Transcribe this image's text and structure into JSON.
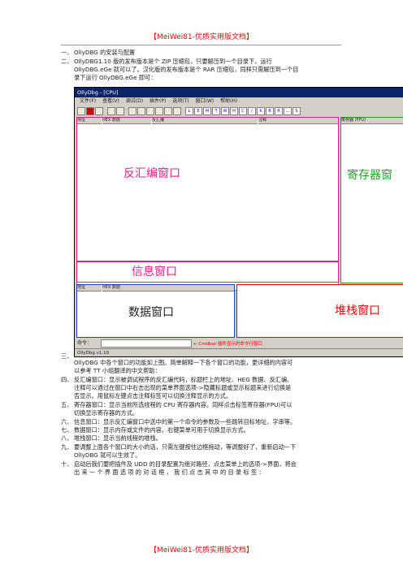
{
  "header_banner": "【MeiWei81-优质实用版文档】",
  "footer_banner": "【MeiWei81-优质实用版文档】",
  "items": [
    {
      "num": "一、",
      "lines": [
        "OllyDBG 的安装与配置"
      ]
    },
    {
      "num": "二、",
      "lines": [
        "OllyDBG1.10 版的发布版本是个 ZIP 压缩包，只要解压到一个目录下，运行",
        "OllyDBG.eGe 就可以了。汉化版的发布版本是个 RAR 压缩包，同样只需解压到一个目",
        "录下运行 OllyDBG.eGe 即可："
      ]
    },
    {
      "num": "三、",
      "lines": [
        "OllyDBG 中各个窗口的功能如上图。简单解释一下各个窗口的功能，更详细的内容可",
        "以参考 TT 小组翻译的中文帮助："
      ]
    },
    {
      "num": "四、",
      "lines": [
        "反汇编窗口：显示被调试程序的反汇编代码，标题栏上的地址、HEG 数据、反汇编、",
        "注释可以通过在窗口中右击出现的菜单界面选项->隐藏标题或显示标题来进行切换是",
        "否显示。用鼠标左键点击注释标签可以切换注释显示的方式。"
      ]
    },
    {
      "num": "五、",
      "lines": [
        "寄存器窗口：显示当前所选线程的 CPU 寄存器内容。同样点击标签寄存器(FPU)可以",
        "切换显示寄存器的方式。"
      ]
    },
    {
      "num": "六、",
      "lines": [
        "信息窗口：显示反汇编窗口中选中的第一个命令的参数及一些跳转目标地址、字串等。"
      ]
    },
    {
      "num": "七、",
      "lines": [
        "数据窗口：显示内存或文件的内容。右键菜单可用于切换显示方式。"
      ]
    },
    {
      "num": "八、",
      "lines": [
        "堆栈窗口：显示当前线程的堆栈。"
      ]
    },
    {
      "num": "九、",
      "lines": [
        "要调整上面各个窗口的大小的话，只需左键按住边框拖动，等调整好了，重新启动一下",
        "OllyDBG 就可以生效了。"
      ]
    },
    {
      "num": "十、",
      "lines": [
        "启动后我们要把插件及 UDD 的目录配置为绝对路径，点击菜单上的选项->界面，将会",
        "出 来 一 个 界 面 选 项 的 对 话 框 ， 我 们 点 击 其 中 的 目 录 标 签 ："
      ]
    }
  ],
  "screenshot": {
    "title": "OllyDbg - [CPU]",
    "menu": [
      "文件(F)",
      "查看(V)",
      "调试(D)",
      "插件(P)",
      "选项(T)",
      "窗口(W)",
      "帮助(H)"
    ],
    "toolbar_letters": [
      "L",
      "E",
      "M",
      "T",
      "W",
      "H",
      "C",
      "/",
      "K",
      "B",
      "R",
      "...",
      "S"
    ],
    "disasm_headers": [
      "地址",
      "HEX 数据",
      "反汇编",
      "注释"
    ],
    "register_header": "寄存器 (FPU)",
    "dump_headers": [
      "地址",
      "HEX 数据"
    ],
    "labels": {
      "disasm": "反汇编窗口",
      "registers": "寄存器窗",
      "info": "信息窗口",
      "dump": "数据窗口",
      "stack": "堆栈窗口"
    },
    "command_label": "命令：",
    "command_annotation": "← Cmdbar 插件显示的命令行窗口",
    "status_text": "OllyDbg v1.10"
  }
}
